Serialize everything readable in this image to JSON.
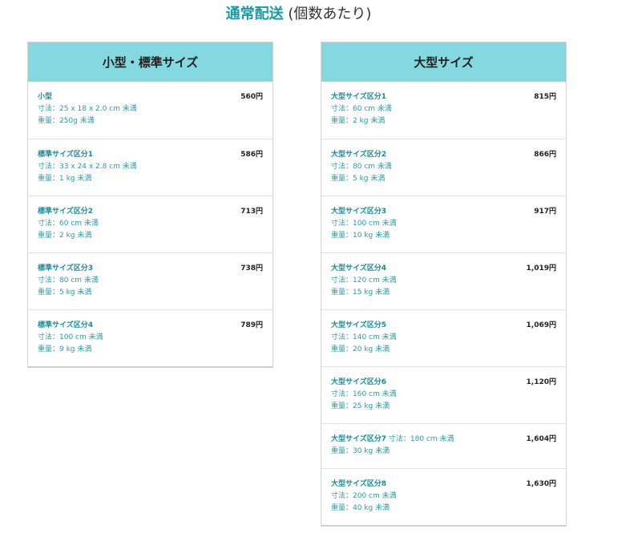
{
  "title": {
    "accent": "通常配送",
    "rest": "(個数あたり)"
  },
  "panels": [
    {
      "header": "小型・標準サイズ",
      "rows": [
        {
          "name": "小型",
          "price": "560円",
          "dims": "寸法：25 x 18 x 2.0 cm 未満",
          "weight": "重量：250g 未満"
        },
        {
          "name": "標準サイズ区分1",
          "price": "586円",
          "dims": "寸法：33 x 24 x 2.8 cm 未満",
          "weight": "重量：1 kg 未満"
        },
        {
          "name": "標準サイズ区分2",
          "price": "713円",
          "dims": "寸法：60 cm 未満",
          "weight": "重量：2 kg 未満"
        },
        {
          "name": "標準サイズ区分3",
          "price": "738円",
          "dims": "寸法：80 cm 未満",
          "weight": "重量：5 kg 未満"
        },
        {
          "name": "標準サイズ区分4",
          "price": "789円",
          "dims": "寸法：100 cm 未満",
          "weight": "重量：9 kg 未満"
        }
      ]
    },
    {
      "header": "大型サイズ",
      "rows": [
        {
          "name": "大型サイズ区分1",
          "price": "815円",
          "dims": "寸法：60 cm 未満",
          "weight": "重量：2 kg 未満"
        },
        {
          "name": "大型サイズ区分2",
          "price": "866円",
          "dims": "寸法：80 cm 未満",
          "weight": "重量：5 kg 未満"
        },
        {
          "name": "大型サイズ区分3",
          "price": "917円",
          "dims": "寸法：100 cm 未満",
          "weight": "重量：10 kg 未満"
        },
        {
          "name": "大型サイズ区分4",
          "price": "1,019円",
          "dims": "寸法：120 cm 未満",
          "weight": "重量：15 kg 未満"
        },
        {
          "name": "大型サイズ区分5",
          "price": "1,069円",
          "dims": "寸法：140 cm 未満",
          "weight": "重量：20 kg 未満"
        },
        {
          "name": "大型サイズ区分6",
          "price": "1,120円",
          "dims": "寸法：160 cm 未満",
          "weight": "重量：25 kg 未満"
        },
        {
          "name": "大型サイズ区分7",
          "price": "1,604円",
          "dims": "寸法：180 cm 未満",
          "weight": "重量：30 kg 未満"
        },
        {
          "name": "大型サイズ区分8",
          "price": "1,630円",
          "dims": "寸法：200 cm 未満",
          "weight": "重量：40 kg 未満"
        }
      ]
    }
  ]
}
